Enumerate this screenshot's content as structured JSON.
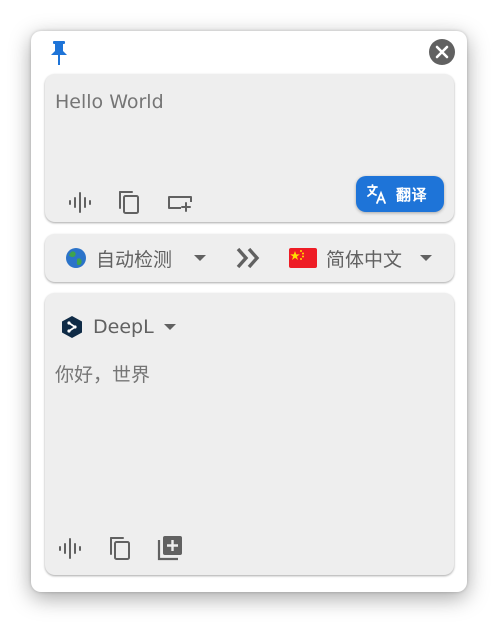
{
  "window": {
    "pin_icon": "pin-icon",
    "close_icon": "close-icon"
  },
  "source": {
    "text": "Hello World",
    "actions": [
      "speak-icon",
      "copy-icon",
      "insert-icon"
    ],
    "translate_label": "翻译",
    "translate_icon": "translate-icon"
  },
  "languages": {
    "from": {
      "label": "自动检测",
      "icon": "globe-icon"
    },
    "swap_icon": "double-chevron-right-icon",
    "to": {
      "label": "简体中文",
      "icon": "china-flag-icon"
    }
  },
  "result": {
    "engine": {
      "name": "DeepL",
      "icon": "deepl-logo-icon"
    },
    "text": "你好，世界",
    "actions": [
      "speak-icon",
      "copy-icon",
      "add-icon"
    ]
  },
  "colors": {
    "accent": "#1e74d8",
    "card_bg": "#eeeeee",
    "icon": "#616161",
    "text": "#757575"
  }
}
